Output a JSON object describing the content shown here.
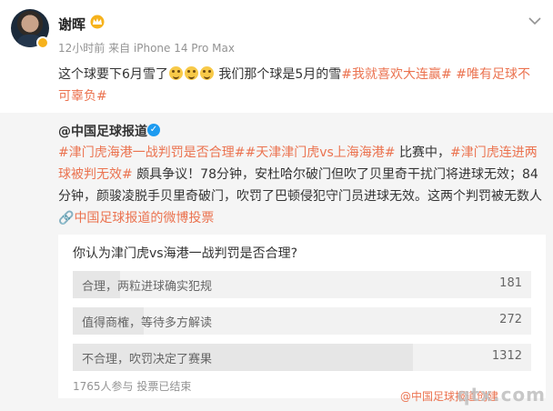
{
  "post": {
    "username": "谢晖",
    "meta": "12小时前 来自 iPhone 14 Pro Max",
    "text_before": "这个球要下6月雪了",
    "text_middle": "我们那个球是5月的雪",
    "tag1": "#我就喜欢大连赢#",
    "tag2": "#唯有足球不可辜负#"
  },
  "repost": {
    "username": "@中国足球报道",
    "tag1": "#津门虎海港一战判罚是否合理#",
    "tag2": "#天津津门虎vs上海海港#",
    "text1": "比赛中，",
    "tag3": "#津门虎连进两球被判无效#",
    "text2": "颇具争议！78分钟，安杜哈尔破门但吹了贝里奇干扰门将进球无效；84分钟，颜骏凌脱手贝里奇破门，吹罚了巴顿侵犯守门员进球无效。这两个判罚被无数人",
    "link": "中国足球报道的微博投票"
  },
  "poll": {
    "question": "你认为津门虎vs海港一战判罚是否合理?",
    "options": [
      {
        "label": "合理，两粒进球确实犯规",
        "count": "181",
        "share": 0.103
      },
      {
        "label": "值得商榷，等待多方解读",
        "count": "272",
        "share": 0.154
      },
      {
        "label": "不合理，吹罚决定了赛果",
        "count": "1312",
        "share": 0.743
      }
    ],
    "footer": "1765人参与 投票已结束"
  },
  "watermark": {
    "text": "@中国足球报道创建",
    "logo": "qtx.com"
  },
  "colors": {
    "accent": "#eb7350",
    "verified": "#1d9bf0",
    "vip": "#f6b21c"
  }
}
